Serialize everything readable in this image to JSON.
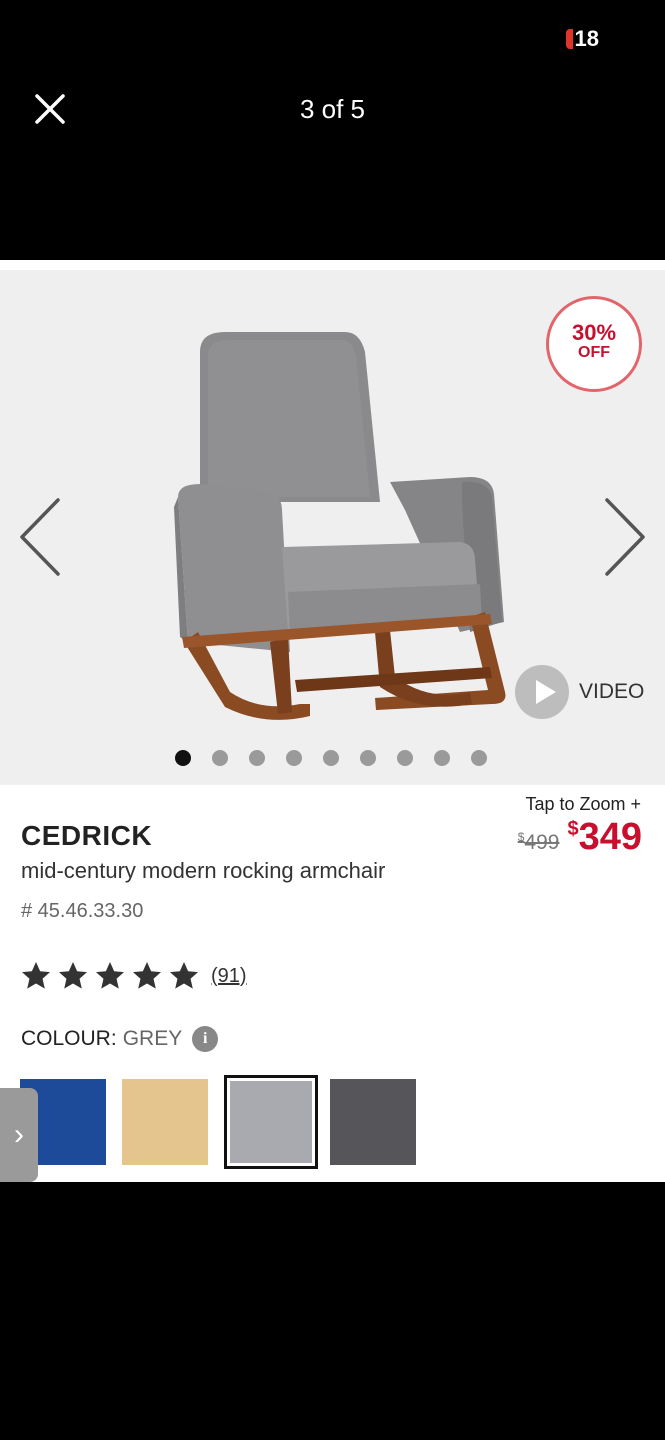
{
  "status_bar": {
    "badge": "18"
  },
  "header": {
    "counter": "3 of 5"
  },
  "gallery": {
    "discount": {
      "percent": "30%",
      "label": "OFF"
    },
    "video_label": "VIDEO",
    "dots_total": 9,
    "dots_active": 1,
    "zoom_label": "Tap to Zoom +"
  },
  "product": {
    "brand": "CEDRICK",
    "description": "mid-century modern rocking armchair",
    "sku": "# 45.46.33.30",
    "old_price_symbol": "$",
    "old_price": "499",
    "new_price_symbol": "$",
    "new_price": "349",
    "rating": 5,
    "reviews": "(91)",
    "colour_label": "COLOUR:",
    "colour_value": "GREY",
    "swatches": [
      "#1e4a9a",
      "#e4c58d",
      "#a9a9b0",
      "#55555a"
    ],
    "selected_swatch": 2
  },
  "colors": {
    "accent": "#c8102e",
    "badge_border": "#e1656a"
  }
}
